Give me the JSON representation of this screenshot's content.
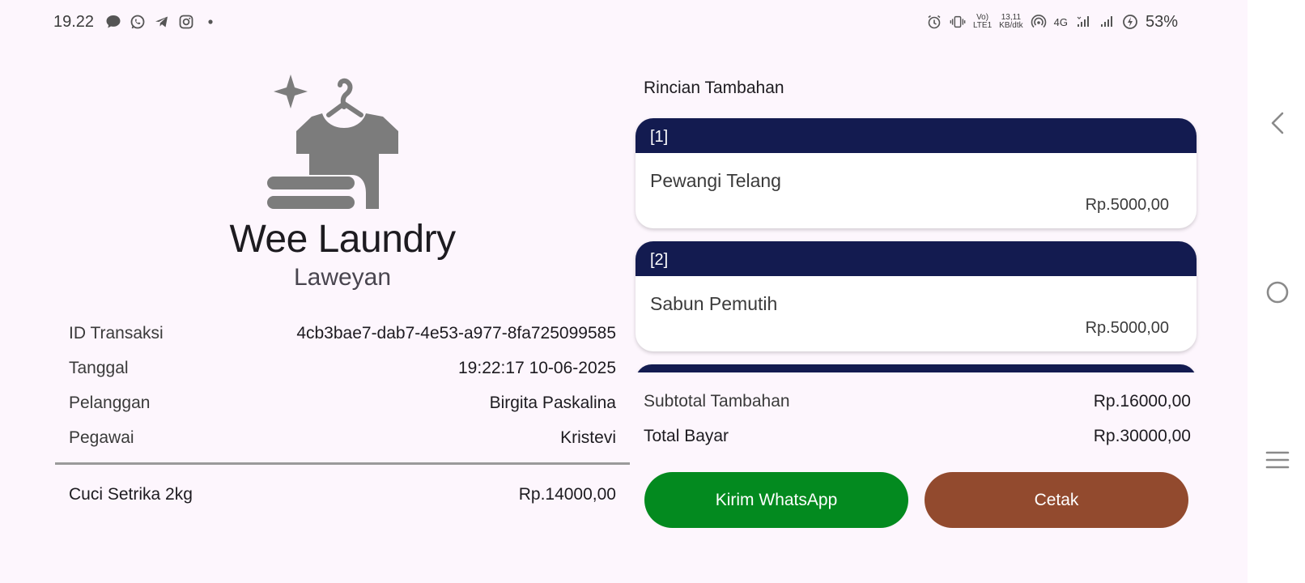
{
  "status_bar": {
    "time": "19.22",
    "left_icons": [
      "message-icon",
      "whatsapp-icon",
      "telegram-icon",
      "instagram-icon",
      "dot-icon"
    ],
    "volte_top": "Vo)",
    "volte_bottom": "LTE1",
    "speed_top": "13,11",
    "speed_bottom": "KB/dtk",
    "network_type": "4G",
    "battery": "53%"
  },
  "store": {
    "name": "Wee Laundry",
    "branch": "Laweyan",
    "logo_icon": "laundry-shirt-hanger-icon"
  },
  "transaction": {
    "rows": [
      {
        "label": "ID Transaksi",
        "value": "4cb3bae7-dab7-4e53-a977-8fa725099585"
      },
      {
        "label": "Tanggal",
        "value": "19:22:17 10-06-2025"
      },
      {
        "label": "Pelanggan",
        "value": "Birgita Paskalina"
      },
      {
        "label": "Pegawai",
        "value": "Kristevi"
      }
    ],
    "service": {
      "label": "Cuci Setrika 2kg",
      "price": "Rp.14000,00"
    }
  },
  "extras": {
    "title": "Rincian Tambahan",
    "items": [
      {
        "index": "[1]",
        "name": "Pewangi Telang",
        "price": "Rp.5000,00"
      },
      {
        "index": "[2]",
        "name": "Sabun Pemutih",
        "price": "Rp.5000,00"
      }
    ]
  },
  "summary": {
    "subtotal_label": "Subtotal Tambahan",
    "subtotal_value": "Rp.16000,00",
    "total_label": "Total Bayar",
    "total_value": "Rp.30000,00"
  },
  "actions": {
    "whatsapp_label": "Kirim WhatsApp",
    "print_label": "Cetak"
  },
  "colors": {
    "card_header": "#131b50",
    "whatsapp_button": "#038a1f",
    "print_button": "#924a2e",
    "background": "#fdf6fd"
  }
}
